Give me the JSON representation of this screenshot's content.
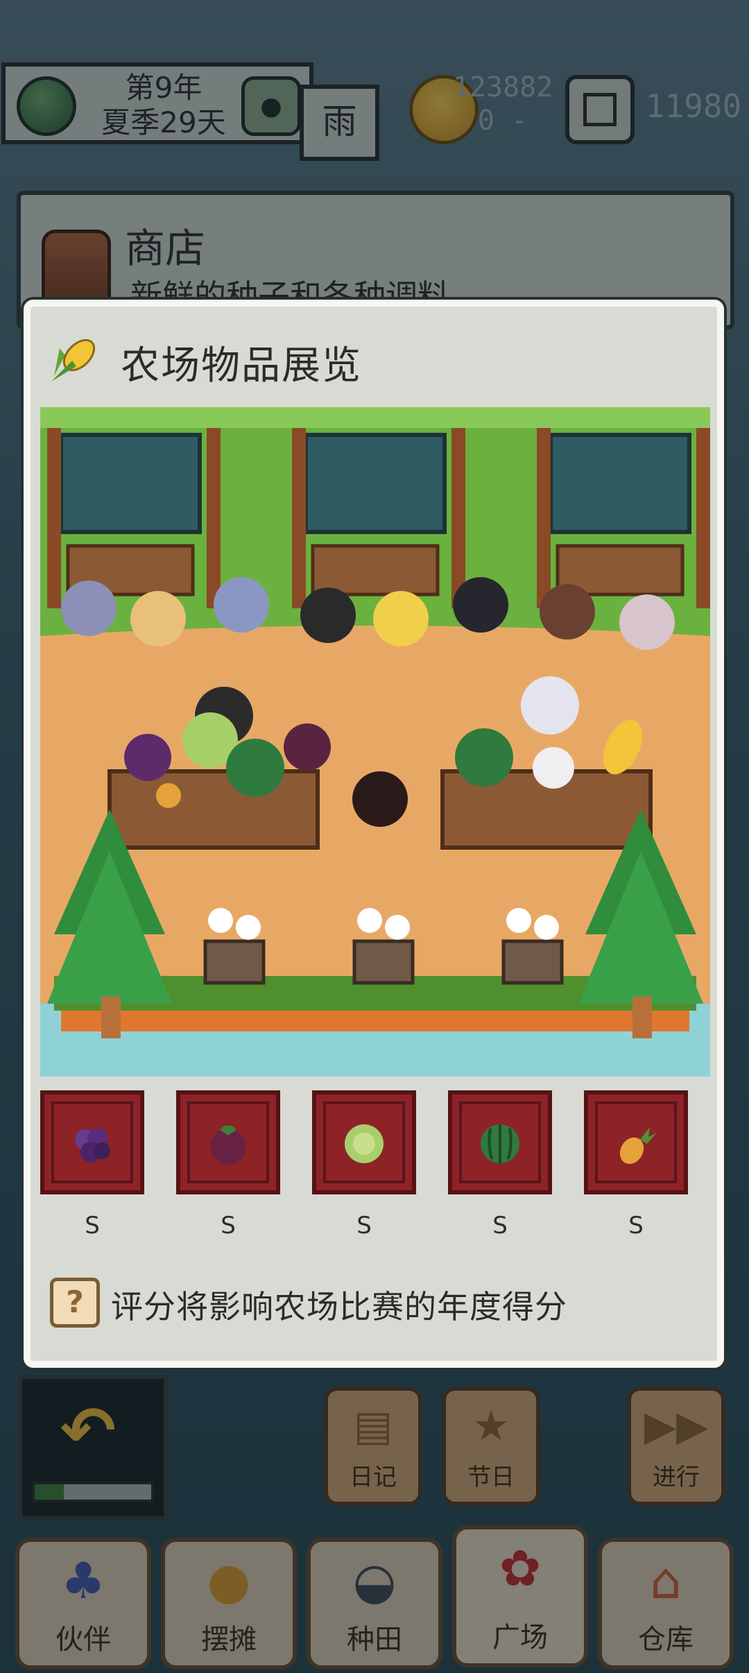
{
  "topbar": {
    "year": "第9年",
    "season_day": "夏季29天",
    "weather": "雨",
    "money": "123882",
    "money_delta": "0 -",
    "gems": "11980",
    "icons": {
      "globe": "globe-icon",
      "settings": "settings-icon",
      "coin": "coin-icon",
      "gem": "gem-icon"
    }
  },
  "shop": {
    "title": "商店",
    "subtitle": "新鲜的种子和各种调料"
  },
  "modal": {
    "title": "农场物品展览",
    "title_icon": "corn-icon",
    "items": [
      {
        "icon": "grape-icon",
        "grade": "S"
      },
      {
        "icon": "mangosteen-icon",
        "grade": "S"
      },
      {
        "icon": "cabbage-icon",
        "grade": "S"
      },
      {
        "icon": "watermelon-icon",
        "grade": "S"
      },
      {
        "icon": "pineapple-icon",
        "grade": "S"
      }
    ],
    "hint": "评分将影响农场比赛的年度得分",
    "hint_icon": "help-icon"
  },
  "actions": {
    "back_progress": 0.25,
    "diary": "日记",
    "festival": "节日",
    "proceed": "进行"
  },
  "nav": [
    {
      "label": "伙伴",
      "icon": "partner-icon"
    },
    {
      "label": "摆摊",
      "icon": "stall-icon"
    },
    {
      "label": "种田",
      "icon": "farming-icon"
    },
    {
      "label": "广场",
      "icon": "plaza-icon"
    },
    {
      "label": "仓库",
      "icon": "warehouse-icon"
    }
  ],
  "colors": {
    "item_frame": "#8d2327",
    "modal_bg": "#d8dbd3",
    "dirt": "#e8a865",
    "grass": "#6bb13f"
  }
}
